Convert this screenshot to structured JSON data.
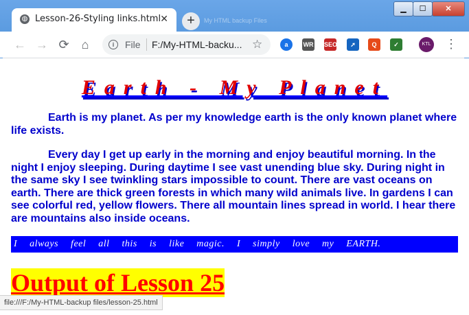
{
  "window": {
    "min_label": "▁",
    "max_label": "☐",
    "close_label": "✕"
  },
  "tab": {
    "title": "Lesson-26-Styling links.html",
    "close_label": "✕",
    "new_tab_label": "+",
    "ghost_title": "My HTML backup Files"
  },
  "toolbar": {
    "back": "←",
    "forward": "→",
    "reload": "⟳",
    "home": "⌂",
    "info": "i",
    "scheme": "File",
    "url": "F:/My-HTML-backu...",
    "star": "☆",
    "menu": "⋮"
  },
  "extensions": [
    {
      "label": "a",
      "color": "#1a73e8"
    },
    {
      "label": "WR",
      "color": "#555555"
    },
    {
      "label": "SEO",
      "color": "#c62828"
    },
    {
      "label": "➚",
      "color": "#1565c0"
    },
    {
      "label": "Q",
      "color": "#e64a19"
    },
    {
      "label": "✓",
      "color": "#2e7d32"
    }
  ],
  "avatar_label": "KTL",
  "page": {
    "heading": "Earth - My Planet",
    "paragraph1": "Earth is my planet. As per my knowledge earth is the only known planet where life exists.",
    "paragraph2": "Every day I get up early in the morning and enjoy beautiful morning. In the night I enjoy sleeping. During daytime I see vast unending blue sky. During night in the same sky I see twinkling stars impossible to count. There are vast oceans on earth. There are thick green forests in which many wild animals live. In gardens I can see colorful red, yellow flowers. There all mountain lines spread in world. I hear there are mountains also inside oceans.",
    "banner": "I always feel all this is like magic. I simply love my EARTH.",
    "output_link": "Output of Lesson 25"
  },
  "status_bar": "file:///F:/My-HTML-backup files/lesson-25.html"
}
